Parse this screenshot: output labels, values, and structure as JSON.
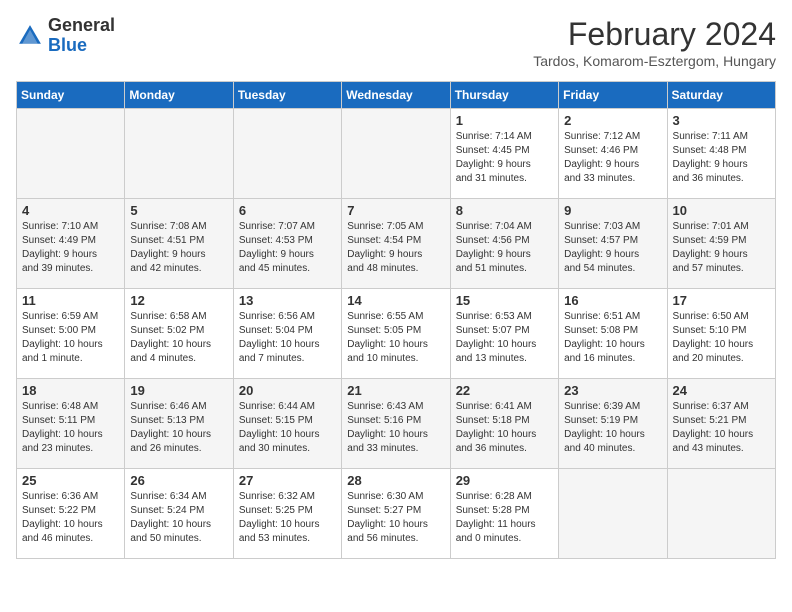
{
  "header": {
    "logo_general": "General",
    "logo_blue": "Blue",
    "month_title": "February 2024",
    "location": "Tardos, Komarom-Esztergom, Hungary"
  },
  "days_of_week": [
    "Sunday",
    "Monday",
    "Tuesday",
    "Wednesday",
    "Thursday",
    "Friday",
    "Saturday"
  ],
  "weeks": [
    [
      {
        "num": "",
        "info": ""
      },
      {
        "num": "",
        "info": ""
      },
      {
        "num": "",
        "info": ""
      },
      {
        "num": "",
        "info": ""
      },
      {
        "num": "1",
        "info": "Sunrise: 7:14 AM\nSunset: 4:45 PM\nDaylight: 9 hours\nand 31 minutes."
      },
      {
        "num": "2",
        "info": "Sunrise: 7:12 AM\nSunset: 4:46 PM\nDaylight: 9 hours\nand 33 minutes."
      },
      {
        "num": "3",
        "info": "Sunrise: 7:11 AM\nSunset: 4:48 PM\nDaylight: 9 hours\nand 36 minutes."
      }
    ],
    [
      {
        "num": "4",
        "info": "Sunrise: 7:10 AM\nSunset: 4:49 PM\nDaylight: 9 hours\nand 39 minutes."
      },
      {
        "num": "5",
        "info": "Sunrise: 7:08 AM\nSunset: 4:51 PM\nDaylight: 9 hours\nand 42 minutes."
      },
      {
        "num": "6",
        "info": "Sunrise: 7:07 AM\nSunset: 4:53 PM\nDaylight: 9 hours\nand 45 minutes."
      },
      {
        "num": "7",
        "info": "Sunrise: 7:05 AM\nSunset: 4:54 PM\nDaylight: 9 hours\nand 48 minutes."
      },
      {
        "num": "8",
        "info": "Sunrise: 7:04 AM\nSunset: 4:56 PM\nDaylight: 9 hours\nand 51 minutes."
      },
      {
        "num": "9",
        "info": "Sunrise: 7:03 AM\nSunset: 4:57 PM\nDaylight: 9 hours\nand 54 minutes."
      },
      {
        "num": "10",
        "info": "Sunrise: 7:01 AM\nSunset: 4:59 PM\nDaylight: 9 hours\nand 57 minutes."
      }
    ],
    [
      {
        "num": "11",
        "info": "Sunrise: 6:59 AM\nSunset: 5:00 PM\nDaylight: 10 hours\nand 1 minute."
      },
      {
        "num": "12",
        "info": "Sunrise: 6:58 AM\nSunset: 5:02 PM\nDaylight: 10 hours\nand 4 minutes."
      },
      {
        "num": "13",
        "info": "Sunrise: 6:56 AM\nSunset: 5:04 PM\nDaylight: 10 hours\nand 7 minutes."
      },
      {
        "num": "14",
        "info": "Sunrise: 6:55 AM\nSunset: 5:05 PM\nDaylight: 10 hours\nand 10 minutes."
      },
      {
        "num": "15",
        "info": "Sunrise: 6:53 AM\nSunset: 5:07 PM\nDaylight: 10 hours\nand 13 minutes."
      },
      {
        "num": "16",
        "info": "Sunrise: 6:51 AM\nSunset: 5:08 PM\nDaylight: 10 hours\nand 16 minutes."
      },
      {
        "num": "17",
        "info": "Sunrise: 6:50 AM\nSunset: 5:10 PM\nDaylight: 10 hours\nand 20 minutes."
      }
    ],
    [
      {
        "num": "18",
        "info": "Sunrise: 6:48 AM\nSunset: 5:11 PM\nDaylight: 10 hours\nand 23 minutes."
      },
      {
        "num": "19",
        "info": "Sunrise: 6:46 AM\nSunset: 5:13 PM\nDaylight: 10 hours\nand 26 minutes."
      },
      {
        "num": "20",
        "info": "Sunrise: 6:44 AM\nSunset: 5:15 PM\nDaylight: 10 hours\nand 30 minutes."
      },
      {
        "num": "21",
        "info": "Sunrise: 6:43 AM\nSunset: 5:16 PM\nDaylight: 10 hours\nand 33 minutes."
      },
      {
        "num": "22",
        "info": "Sunrise: 6:41 AM\nSunset: 5:18 PM\nDaylight: 10 hours\nand 36 minutes."
      },
      {
        "num": "23",
        "info": "Sunrise: 6:39 AM\nSunset: 5:19 PM\nDaylight: 10 hours\nand 40 minutes."
      },
      {
        "num": "24",
        "info": "Sunrise: 6:37 AM\nSunset: 5:21 PM\nDaylight: 10 hours\nand 43 minutes."
      }
    ],
    [
      {
        "num": "25",
        "info": "Sunrise: 6:36 AM\nSunset: 5:22 PM\nDaylight: 10 hours\nand 46 minutes."
      },
      {
        "num": "26",
        "info": "Sunrise: 6:34 AM\nSunset: 5:24 PM\nDaylight: 10 hours\nand 50 minutes."
      },
      {
        "num": "27",
        "info": "Sunrise: 6:32 AM\nSunset: 5:25 PM\nDaylight: 10 hours\nand 53 minutes."
      },
      {
        "num": "28",
        "info": "Sunrise: 6:30 AM\nSunset: 5:27 PM\nDaylight: 10 hours\nand 56 minutes."
      },
      {
        "num": "29",
        "info": "Sunrise: 6:28 AM\nSunset: 5:28 PM\nDaylight: 11 hours\nand 0 minutes."
      },
      {
        "num": "",
        "info": ""
      },
      {
        "num": "",
        "info": ""
      }
    ]
  ]
}
